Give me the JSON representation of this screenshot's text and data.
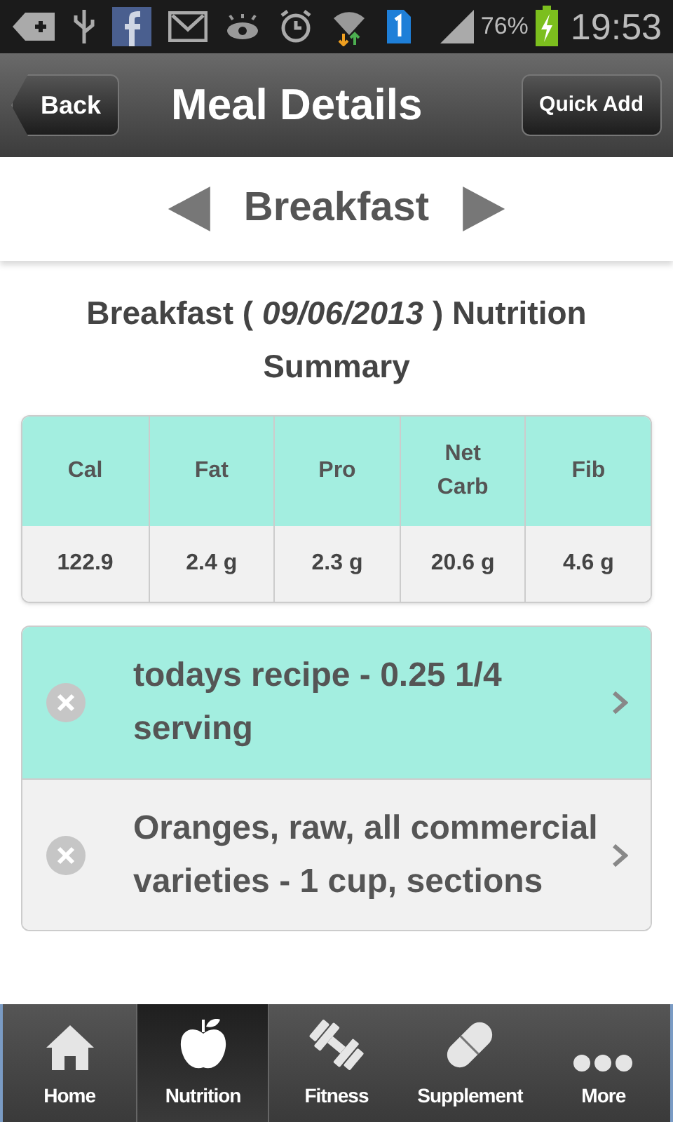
{
  "status_bar": {
    "battery_text": "76%",
    "time": "19:53"
  },
  "nav_bar": {
    "back": "Back",
    "title": "Meal Details",
    "action": "Quick Add"
  },
  "meal_selector": {
    "label": "Breakfast"
  },
  "summary_title": "Breakfast ( *09/06/2013* ) Nutrition Summary",
  "table": {
    "columns": [
      "Cal",
      "Fat",
      "Pro",
      "Net Carb",
      "Fib"
    ],
    "rows": [
      [
        "122.9",
        "2.4 g",
        "2.3 g",
        "20.6 g",
        "4.6 g"
      ]
    ]
  },
  "items": [
    {
      "label": "todays recipe - 0.25 1/4 serving",
      "selected": true
    },
    {
      "label": "Oranges, raw, all commercial varieties - 1 cup, sections",
      "selected": false
    }
  ],
  "tabs": [
    {
      "label": "Home",
      "kind": "home",
      "selected": false
    },
    {
      "label": "Nutrition",
      "kind": "nutrition",
      "selected": true
    },
    {
      "label": "Fitness",
      "kind": "fitness",
      "selected": false
    },
    {
      "label": "Supplement",
      "kind": "supplement",
      "selected": false
    },
    {
      "label": "More",
      "kind": "more",
      "selected": false
    }
  ]
}
